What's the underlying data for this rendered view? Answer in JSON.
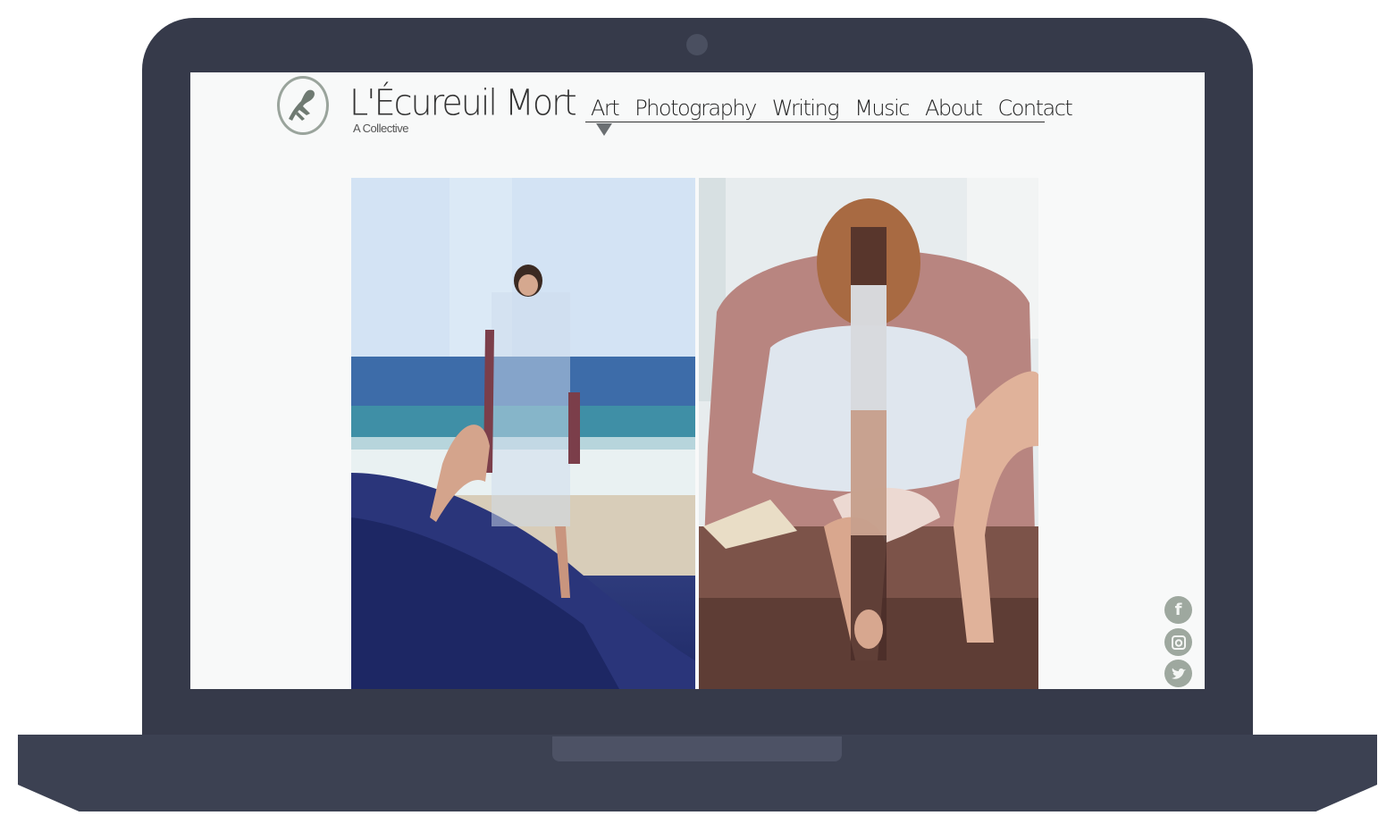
{
  "site": {
    "title": "L'Écureuil Mort",
    "subtitle": "A Collective"
  },
  "nav": {
    "items": [
      {
        "label": "Art"
      },
      {
        "label": "Photography"
      },
      {
        "label": "Writing"
      },
      {
        "label": "Music"
      },
      {
        "label": "About"
      },
      {
        "label": "Contact"
      }
    ],
    "active": "Art"
  },
  "gallery": {
    "left_image": "collage-beach-woman",
    "right_image": "collage-armchair-woman"
  },
  "social": {
    "icons": [
      "facebook-icon",
      "instagram-icon",
      "twitter-icon"
    ],
    "color": "#9ea89f"
  },
  "colors": {
    "laptop_frame": "#363a4a",
    "screen_background": "#f8f9f9",
    "logo_accent": "#9aa49c"
  }
}
